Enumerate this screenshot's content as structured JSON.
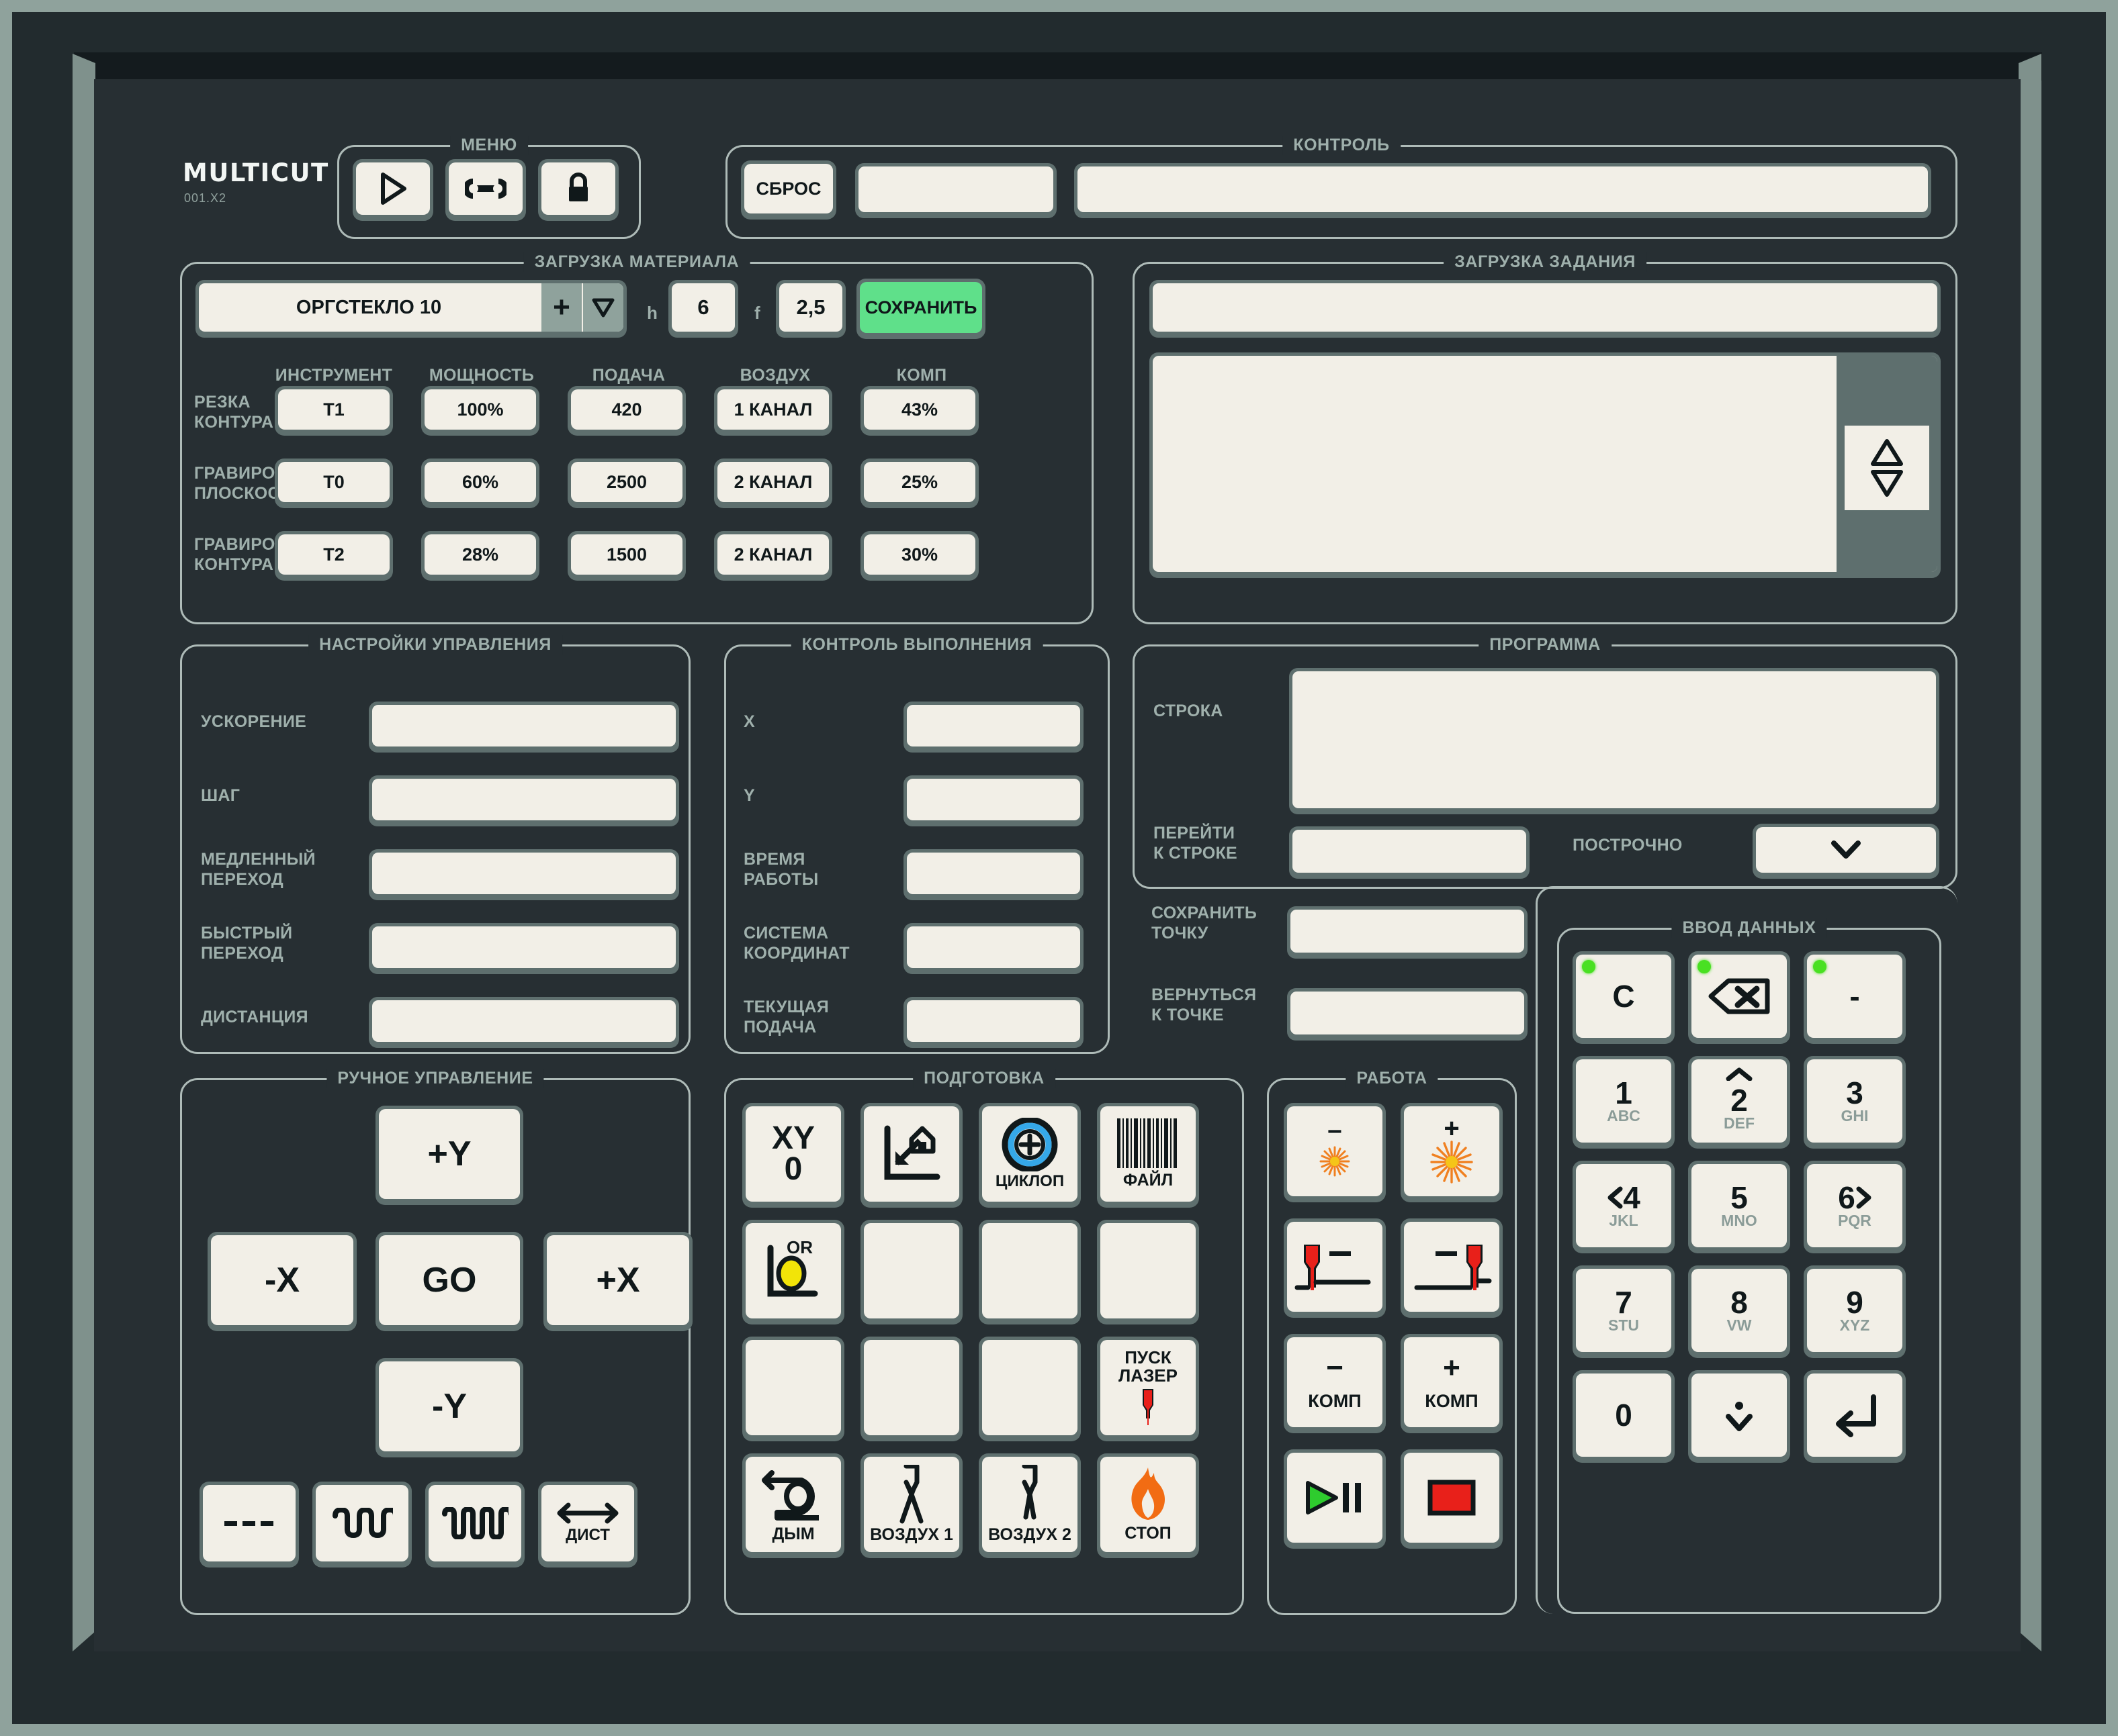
{
  "brand": {
    "name": "MULTICUT",
    "version": "001.X2"
  },
  "menu": {
    "title": "МЕНЮ",
    "buttons": [
      {
        "icon": "play-icon",
        "name": "menu-play-button"
      },
      {
        "icon": "wrench-icon",
        "name": "menu-service-button"
      },
      {
        "icon": "lock-icon",
        "name": "menu-lock-button"
      }
    ]
  },
  "control": {
    "title": "КОНТРОЛЬ",
    "reset_label": "СБРОС",
    "status_small": "",
    "status_wide": ""
  },
  "material": {
    "title": "ЗАГРУЗКА МАТЕРИАЛА",
    "selected": "ОРГСТЕКЛО 10",
    "plus_label": "+",
    "dropdown_icon": "triangle-down-icon",
    "h_label": "h",
    "h_value": "6",
    "f_label": "f",
    "f_value": "2,5",
    "save_label": "СОХРАНИТЬ",
    "save_color": "#5fe08a",
    "columns": [
      "ИНСТРУМЕНТ",
      "МОЩНОСТЬ",
      "ПОДАЧА",
      "ВОЗДУХ",
      "КОМП"
    ],
    "rows": [
      {
        "label": "РЕЗКА\nКОНТУРА",
        "label_l1": "РЕЗКА",
        "label_l2": "КОНТУРА",
        "tool": "T1",
        "power": "100%",
        "feed": "420",
        "air": "1 КАНАЛ",
        "comp": "43%"
      },
      {
        "label_l1": "ГРАВИРОВКА",
        "label_l2": "ПЛОСКОСТИ",
        "tool": "T0",
        "power": "60%",
        "feed": "2500",
        "air": "2 КАНАЛ",
        "comp": "25%"
      },
      {
        "label_l1": "ГРАВИРОВКА",
        "label_l2": "КОНТУРА",
        "tool": "T2",
        "power": "28%",
        "feed": "1500",
        "air": "2 КАНАЛ",
        "comp": "30%"
      }
    ]
  },
  "job": {
    "title": "ЗАГРУЗКА ЗАДАНИЯ",
    "path_value": "",
    "list_value": "",
    "scroll_icon": "scroll-up-down-icon"
  },
  "settings": {
    "title": "НАСТРОЙКИ УПРАВЛЕНИЯ",
    "rows": [
      {
        "l1": "УСКОРЕНИЕ",
        "l2": "",
        "value": ""
      },
      {
        "l1": "ШАГ",
        "l2": "",
        "value": ""
      },
      {
        "l1": "МЕДЛЕННЫЙ",
        "l2": "ПЕРЕХОД",
        "value": ""
      },
      {
        "l1": "БЫСТРЫЙ",
        "l2": "ПЕРЕХОД",
        "value": ""
      },
      {
        "l1": "ДИСТАНЦИЯ",
        "l2": "",
        "value": ""
      }
    ]
  },
  "execution": {
    "title": "КОНТРОЛЬ ВЫПОЛНЕНИЯ",
    "rows": [
      {
        "l1": "X",
        "l2": "",
        "value": ""
      },
      {
        "l1": "Y",
        "l2": "",
        "value": ""
      },
      {
        "l1": "ВРЕМЯ",
        "l2": "РАБОТЫ",
        "value": ""
      },
      {
        "l1": "СИСТЕМА",
        "l2": "КООРДИНАТ",
        "value": ""
      },
      {
        "l1": "ТЕКУЩАЯ",
        "l2": "ПОДАЧА",
        "value": ""
      }
    ]
  },
  "program": {
    "title": "ПРОГРАММА",
    "line_label": "СТРОКА",
    "line_value": "",
    "goto_l1": "ПЕРЕЙТИ",
    "goto_l2": "К СТРОКЕ",
    "goto_value": "",
    "savept_l1": "СОХРАНИТЬ",
    "savept_l2": "ТОЧКУ",
    "savept_value": "",
    "returnpt_l1": "ВЕРНУТЬСЯ",
    "returnpt_l2": "К ТОЧКЕ",
    "returnpt_value": "",
    "stepwise_label": "ПОСТРОЧНО",
    "stepwise_icon": "chevron-down-icon"
  },
  "manual": {
    "title": "РУЧНОЕ УПРАВЛЕНИЕ",
    "plus_y": "+Y",
    "minus_x": "-X",
    "go": "GO",
    "plus_x": "+X",
    "minus_y": "-Y",
    "mode_dash": "- - -",
    "mode_wave_slow_icon": "wave-slow-icon",
    "mode_wave_fast_icon": "wave-fast-icon",
    "dist_icon": "arrows-horizontal-icon",
    "dist_label": "ДИСТ"
  },
  "preparation": {
    "title": "ПОДГОТОВКА",
    "xy_zero_l1": "XY",
    "xy_zero_l2": "0",
    "home_icon": "go-home-icon",
    "cyclop_icon": "cyclop-target-icon",
    "cyclop_label": "ЦИКЛОП",
    "file_icon": "barcode-icon",
    "file_label": "ФАЙЛ",
    "origin_icon": "origin-point-icon",
    "origin_label": "OR",
    "laser_start_l1": "ПУСК",
    "laser_start_l2": "ЛАЗЕР",
    "laser_start_icon": "laser-head-icon",
    "smoke_icon": "smoke-extractor-icon",
    "smoke_label": "ДЫМ",
    "air1_icon": "nozzle-icon",
    "air1_label": "ВОЗДУХ 1",
    "air2_icon": "nozzle-icon",
    "air2_label": "ВОЗДУХ 2",
    "stop_icon": "flame-icon",
    "stop_label": "СТОП"
  },
  "work": {
    "title": "РАБОТА",
    "power_minus_sign": "−",
    "power_minus_icon": "laser-burst-small-icon",
    "power_plus_sign": "+",
    "power_plus_icon": "laser-burst-large-icon",
    "height_minus_sign": "−",
    "height_minus_icon": "head-down-icon",
    "height_plus_sign": "+",
    "height_plus_icon": "head-up-icon",
    "comp_minus_sign": "−",
    "comp_minus_label": "КОМП",
    "comp_plus_sign": "+",
    "comp_plus_label": "КОМП",
    "play_pause_icon": "play-pause-icon",
    "stop_icon": "stop-square-icon"
  },
  "keypad": {
    "title": "ВВОД ДАННЫХ",
    "keys": [
      {
        "main": "C",
        "sub": "",
        "led": true,
        "icon": ""
      },
      {
        "main": "",
        "sub": "",
        "led": true,
        "icon": "backspace-icon"
      },
      {
        "main": "-",
        "sub": "",
        "led": true,
        "icon": ""
      },
      {
        "main": "1",
        "sub": "ABC",
        "led": false,
        "icon": ""
      },
      {
        "main": "2",
        "sub": "DEF",
        "led": false,
        "icon": "caret-up-icon"
      },
      {
        "main": "3",
        "sub": "GHI",
        "led": false,
        "icon": ""
      },
      {
        "main": "4",
        "sub": "JKL",
        "led": false,
        "icon": "caret-left-icon"
      },
      {
        "main": "5",
        "sub": "MNO",
        "led": false,
        "icon": ""
      },
      {
        "main": "6",
        "sub": "PQR",
        "led": false,
        "icon": "caret-right-icon"
      },
      {
        "main": "7",
        "sub": "STU",
        "led": false,
        "icon": ""
      },
      {
        "main": "8",
        "sub": "VW",
        "led": false,
        "icon": ""
      },
      {
        "main": "9",
        "sub": "XYZ",
        "led": false,
        "icon": ""
      },
      {
        "main": "0",
        "sub": "",
        "led": false,
        "icon": ""
      },
      {
        "main": "",
        "sub": "",
        "led": false,
        "icon": "dot-down-icon"
      },
      {
        "main": "",
        "sub": "",
        "led": false,
        "icon": "enter-icon"
      }
    ]
  },
  "colors": {
    "panel_bg": "#272f33",
    "bezel": "#8fa29c",
    "key_cap": "#f2efe7",
    "key_base": "#5e6f6e",
    "group_border": "#aebbb8",
    "label": "#9fb0ac",
    "led_green": "#49e022",
    "save_green": "#5fe08a",
    "laser_red": "#e8201a",
    "flame_orange": "#f26c13",
    "cyclop_blue": "#35a8e8",
    "origin_yellow": "#f2e408"
  }
}
